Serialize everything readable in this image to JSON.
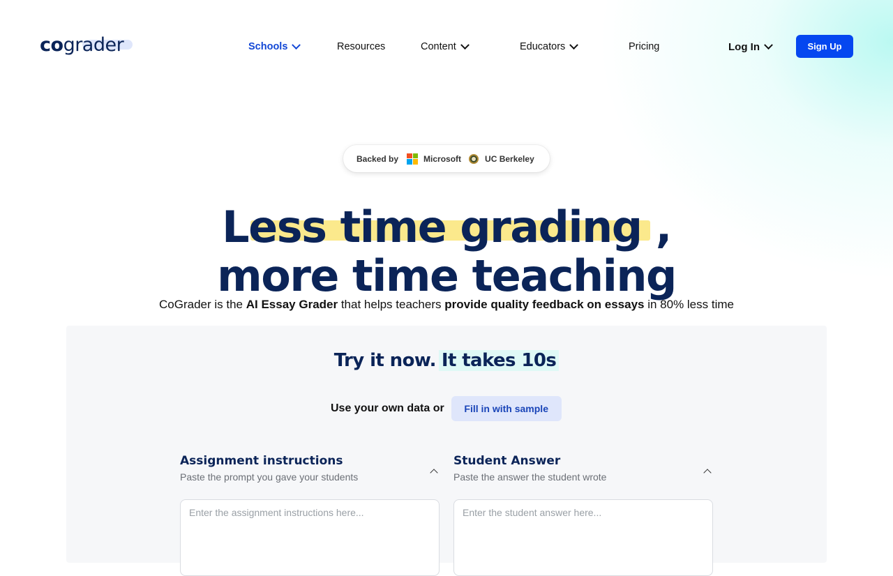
{
  "header": {
    "logo_part1": "co",
    "logo_part2": "grader",
    "nav": [
      {
        "label": "Schools",
        "has_dropdown": true,
        "active": true
      },
      {
        "label": "Resources",
        "has_dropdown": false
      },
      {
        "label": "Content",
        "has_dropdown": true
      },
      {
        "label": "Educators",
        "has_dropdown": true
      },
      {
        "label": "Pricing",
        "has_dropdown": false
      }
    ],
    "login_label": "Log In",
    "signup_label": "Sign Up"
  },
  "backed": {
    "label": "Backed by",
    "partners": [
      "Microsoft",
      "UC Berkeley"
    ],
    "microsoft_colors": [
      "#f25022",
      "#7fba00",
      "#00a4ef",
      "#ffb900"
    ]
  },
  "hero": {
    "line1": "Less time grading ,",
    "line2": "more time teaching",
    "subtitle_parts": [
      "CoGrader is the ",
      "AI Essay Grader",
      " that helps teachers ",
      "provide quality feedback on essays",
      " in 80% less time"
    ]
  },
  "try_section": {
    "title_part1": "Try it now.",
    "title_part2": "It takes 10s",
    "use_text": "Use your own data or",
    "fill_button": "Fill in with sample"
  },
  "columns": [
    {
      "title": "Assignment instructions",
      "description": "Paste the prompt you gave your students",
      "placeholder": "Enter the assignment instructions here..."
    },
    {
      "title": "Student Answer",
      "description": "Paste the answer the student wrote",
      "placeholder": "Enter the student answer here..."
    }
  ],
  "colors": {
    "brand_navy": "#0b2458",
    "primary_blue": "#0547f0",
    "highlight_yellow": "#fbe98c",
    "highlight_mint": "#dff9f6"
  }
}
